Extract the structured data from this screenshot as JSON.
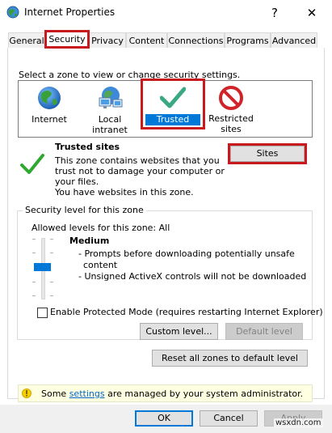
{
  "window": {
    "title": "Internet Properties",
    "help_glyph": "?",
    "close_glyph": "✕"
  },
  "tabs": [
    {
      "label": "General"
    },
    {
      "label": "Security"
    },
    {
      "label": "Privacy"
    },
    {
      "label": "Content"
    },
    {
      "label": "Connections"
    },
    {
      "label": "Programs"
    },
    {
      "label": "Advanced"
    }
  ],
  "zones": {
    "prompt": "Select a zone to view or change security settings.",
    "items": [
      {
        "label": "Internet",
        "icon": "globe-icon"
      },
      {
        "label": "Local intranet",
        "icon": "intranet-icon"
      },
      {
        "label": "Trusted sites",
        "icon": "checkmark-icon",
        "selected": true
      },
      {
        "label": "Restricted",
        "label2": "sites",
        "icon": "restricted-icon"
      }
    ]
  },
  "zone_info": {
    "title": "Trusted sites",
    "line1": "This zone contains websites that you",
    "line2": "trust not to damage your computer or",
    "line3": "your files.",
    "line4": "You have websites in this zone.",
    "sites_button": "Sites"
  },
  "security_level": {
    "legend": "Security level for this zone",
    "allowed": "Allowed levels for this zone: All",
    "level_name": "Medium",
    "bullet1a": "- Prompts before downloading potentially unsafe",
    "bullet1b": "content",
    "bullet2": "- Unsigned ActiveX controls will not be downloaded",
    "protected_mode": "Enable Protected Mode (requires restarting Internet Explorer)",
    "protected_mode_checked": false,
    "custom_level": "Custom level...",
    "default_level": "Default level",
    "reset_all": "Reset all zones to default level"
  },
  "info_bar": {
    "prefix": "Some ",
    "link": "settings",
    "suffix": " are managed by your system administrator."
  },
  "footer": {
    "ok": "OK",
    "cancel": "Cancel",
    "apply": "Apply",
    "watermark": "wsxdn.com"
  },
  "colors": {
    "highlight": "#c8191f",
    "selection": "#0078d7",
    "link": "#0066cc"
  }
}
